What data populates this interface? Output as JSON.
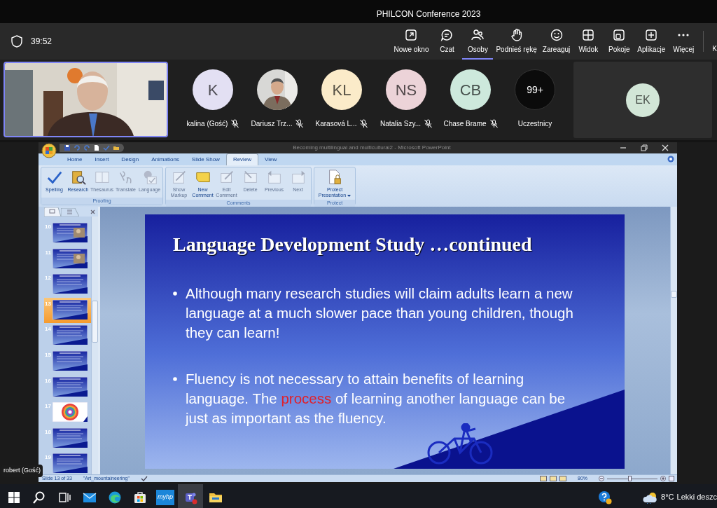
{
  "meeting": {
    "title": "PHILCON Conference 2023",
    "elapsed": "39:52"
  },
  "toolbar": [
    {
      "label": "Nowe okno",
      "selected": false
    },
    {
      "label": "Czat",
      "selected": false
    },
    {
      "label": "Osoby",
      "selected": true
    },
    {
      "label": "Podnieś rękę",
      "selected": false
    },
    {
      "label": "Zareaguj",
      "selected": false
    },
    {
      "label": "Widok",
      "selected": false
    },
    {
      "label": "Pokoje",
      "selected": false
    },
    {
      "label": "Aplikacje",
      "selected": false
    },
    {
      "label": "Więcej",
      "selected": false
    },
    {
      "label": "K",
      "selected": false
    }
  ],
  "participants": [
    {
      "kind": "initials",
      "initials": "K",
      "name": "kalina (Gość)",
      "color": "#e3e0f3",
      "muted": true
    },
    {
      "name": "Dariusz Trz...",
      "muted": true
    },
    {
      "kind": "initials",
      "initials": "KL",
      "name": "Karasová L...",
      "color": "#fbebc9",
      "muted": true
    },
    {
      "kind": "initials",
      "initials": "NS",
      "name": "Natalia Szy...",
      "color": "#ecd3d8",
      "muted": true
    },
    {
      "kind": "initials",
      "initials": "CB",
      "name": "Chase Brame",
      "color": "#cde9dc",
      "muted": true
    },
    {
      "kind": "count",
      "initials": "99+",
      "name": "Uczestnicy",
      "muted": false
    }
  ],
  "side_tile": {
    "initials": "EK",
    "color": "#d2e6d7"
  },
  "caption": "robert (Gość)",
  "powerpoint": {
    "title": "Becoming multilingual and multicultural2 - Microsoft PowerPoint",
    "tabs": [
      {
        "label": "Home",
        "selected": false
      },
      {
        "label": "Insert",
        "selected": false
      },
      {
        "label": "Design",
        "selected": false
      },
      {
        "label": "Animations",
        "selected": false
      },
      {
        "label": "Slide Show",
        "selected": false
      },
      {
        "label": "Review",
        "selected": true
      },
      {
        "label": "View",
        "selected": false
      }
    ],
    "groups": [
      {
        "name": "Proofing",
        "buttons": [
          {
            "label": "Spelling",
            "disabled": false
          },
          {
            "label": "Research",
            "disabled": false
          },
          {
            "label": "Thesaurus",
            "disabled": true
          },
          {
            "label": "Translate",
            "disabled": true
          },
          {
            "label": "Language",
            "disabled": true
          }
        ]
      },
      {
        "name": "Comments",
        "buttons": [
          {
            "label": "Show Markup",
            "disabled": true
          },
          {
            "label": "New Comment",
            "disabled": false
          },
          {
            "label": "Edit Comment",
            "disabled": true
          },
          {
            "label": "Delete",
            "disabled": true
          },
          {
            "label": "Previous",
            "disabled": true
          },
          {
            "label": "Next",
            "disabled": true
          }
        ]
      },
      {
        "name": "Protect",
        "buttons": [
          {
            "label": "Protect Presentation",
            "disabled": false
          }
        ]
      }
    ],
    "thumbnails": [
      {
        "number": "10",
        "selected": false
      },
      {
        "number": "11",
        "selected": false
      },
      {
        "number": "12",
        "kind": "text",
        "selected": false
      },
      {
        "number": "13",
        "kind": "text",
        "selected": true
      },
      {
        "number": "14",
        "kind": "text",
        "selected": false
      },
      {
        "number": "15",
        "kind": "text",
        "selected": false
      },
      {
        "number": "16",
        "kind": "text",
        "selected": false
      },
      {
        "number": "17",
        "kind": "rings",
        "selected": false
      },
      {
        "number": "18",
        "kind": "text",
        "selected": false
      },
      {
        "number": "19",
        "kind": "text",
        "selected": false
      }
    ],
    "slide": {
      "title": "Language Development Study …continued",
      "bullets": [
        [
          {
            "text": "Although many research studies will claim adults learn a new language at a much slower pace than young children, though they can learn!",
            "highlight": false
          }
        ],
        [
          {
            "text": "Fluency is not necessary to attain benefits of learning language. The ",
            "highlight": false
          },
          {
            "text": "process",
            "highlight": true
          },
          {
            "text": " of learning another language can be just as important as the fluency.",
            "highlight": false
          }
        ]
      ]
    },
    "status": {
      "slide": "Slide 13 of 33",
      "theme": "\"Art_mountaineering\"",
      "zoom": "80%",
      "level": 0.45
    }
  },
  "taskbar": {
    "app_label": "myhp",
    "temperature": "8°C",
    "weather": "Lekki deszc"
  }
}
